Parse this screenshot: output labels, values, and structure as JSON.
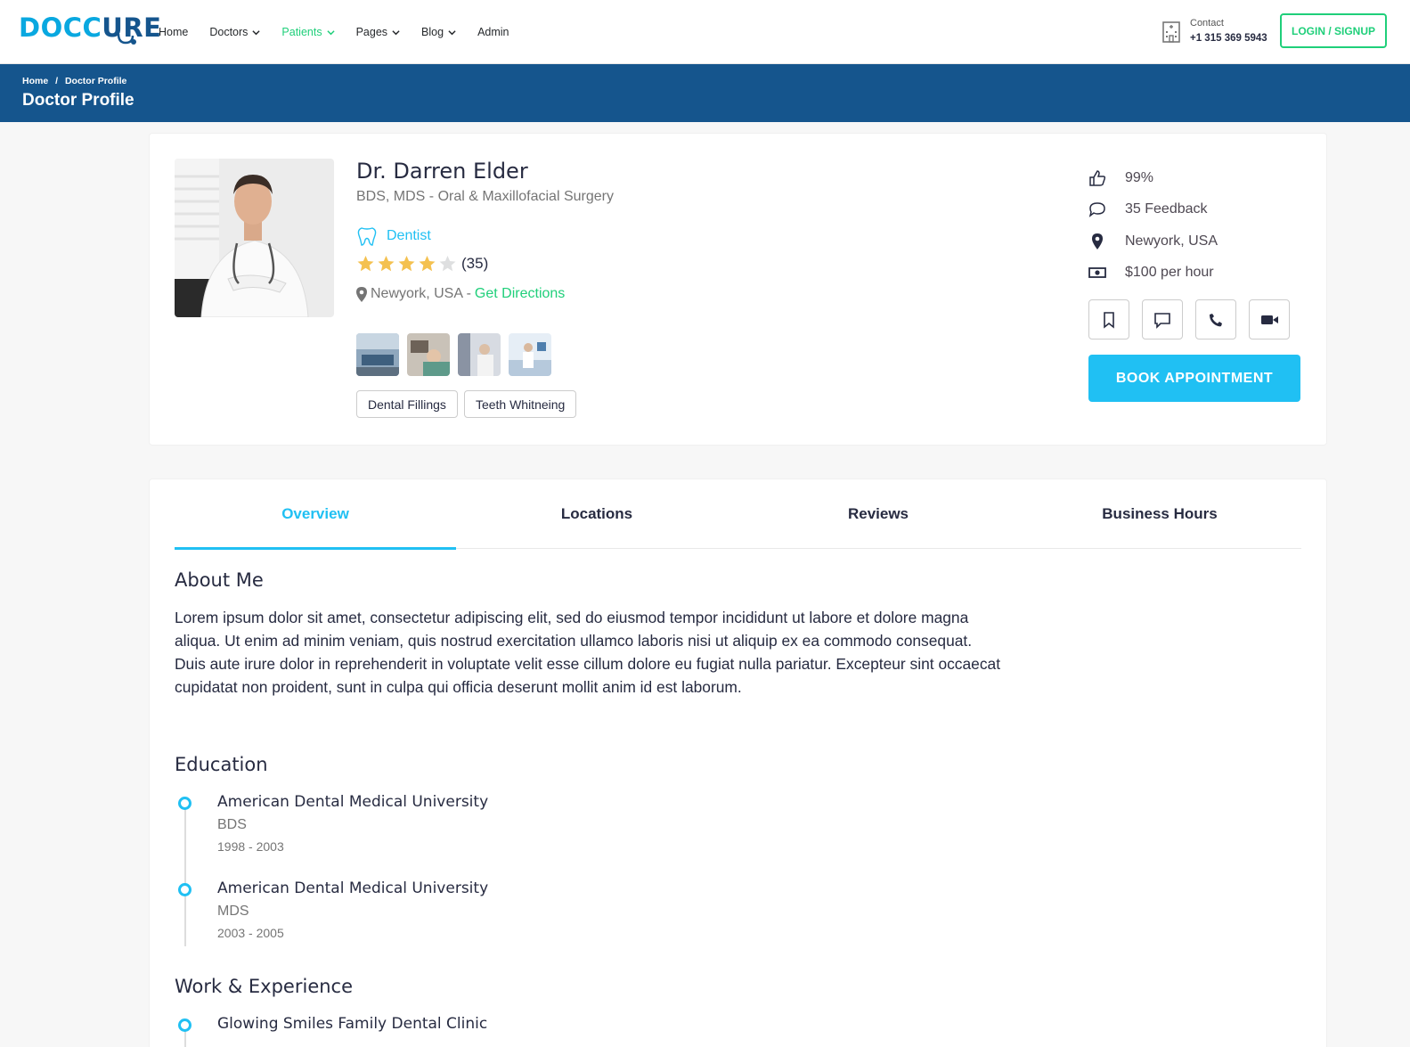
{
  "brand": {
    "logo_part1": "DOCC",
    "logo_part2": "URE",
    "accent": "#20c0f3",
    "primary": "#15558d",
    "green": "#1fcf7a"
  },
  "nav": {
    "items": [
      {
        "label": "Home",
        "dropdown": false,
        "active": false
      },
      {
        "label": "Doctors",
        "dropdown": true,
        "active": false
      },
      {
        "label": "Patients",
        "dropdown": true,
        "active": true
      },
      {
        "label": "Pages",
        "dropdown": true,
        "active": false
      },
      {
        "label": "Blog",
        "dropdown": true,
        "active": false
      },
      {
        "label": "Admin",
        "dropdown": false,
        "active": false
      }
    ],
    "contact_label": "Contact",
    "contact_phone": "+1 315 369 5943",
    "login_label": "LOGIN / SIGNUP"
  },
  "breadcrumb": {
    "home": "Home",
    "separator": "/",
    "current": "Doctor Profile",
    "page_title": "Doctor Profile"
  },
  "doctor": {
    "name": "Dr. Darren Elder",
    "speciality": "BDS, MDS - Oral & Maxillofacial Surgery",
    "department": "Dentist",
    "rating_stars": 4,
    "rating_max": 5,
    "rating_count": "(35)",
    "location": "Newyork, USA -",
    "directions_label": "Get Directions",
    "services": [
      "Dental Fillings",
      "Teeth Whitneing"
    ]
  },
  "stats": {
    "likes": "99%",
    "feedback": "35 Feedback",
    "location": "Newyork, USA",
    "price": "$100 per hour"
  },
  "actions": {
    "book_label": "BOOK APPOINTMENT"
  },
  "tabs": [
    "Overview",
    "Locations",
    "Reviews",
    "Business Hours"
  ],
  "overview": {
    "about_title": "About Me",
    "about_text": "Lorem ipsum dolor sit amet, consectetur adipiscing elit, sed do eiusmod tempor incididunt ut labore et dolore magna aliqua. Ut enim ad minim veniam, quis nostrud exercitation ullamco laboris nisi ut aliquip ex ea commodo consequat. Duis aute irure dolor in reprehenderit in voluptate velit esse cillum dolore eu fugiat nulla pariatur. Excepteur sint occaecat cupidatat non proident, sunt in culpa qui officia deserunt mollit anim id est laborum.",
    "education_title": "Education",
    "education": [
      {
        "school": "American Dental Medical University",
        "degree": "BDS",
        "years": "1998 - 2003"
      },
      {
        "school": "American Dental Medical University",
        "degree": "MDS",
        "years": "2003 - 2005"
      }
    ],
    "work_title": "Work & Experience",
    "work": [
      {
        "place": "Glowing Smiles Family Dental Clinic"
      }
    ]
  }
}
